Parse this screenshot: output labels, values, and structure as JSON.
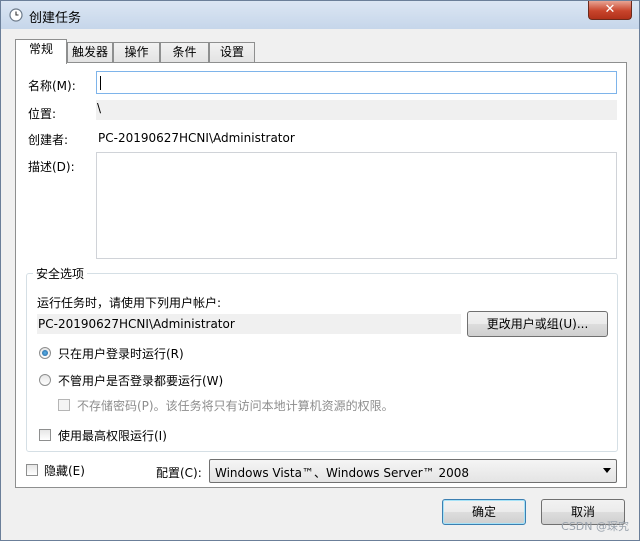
{
  "window": {
    "title": "创建任务",
    "close_glyph": "✕"
  },
  "tabs": [
    {
      "label": "常规"
    },
    {
      "label": "触发器"
    },
    {
      "label": "操作"
    },
    {
      "label": "条件"
    },
    {
      "label": "设置"
    }
  ],
  "general": {
    "name_label": "名称(M):",
    "name_value": "",
    "location_label": "位置:",
    "location_value": "\\",
    "author_label": "创建者:",
    "author_value": "PC-20190627HCNI\\Administrator",
    "description_label": "描述(D):",
    "description_value": ""
  },
  "security": {
    "group_title": "安全选项",
    "run_as_label": "运行任务时，请使用下列用户帐户:",
    "user_account": "PC-20190627HCNI\\Administrator",
    "change_user_button": "更改用户或组(U)...",
    "radio_logged_on": "只在用户登录时运行(R)",
    "radio_whether_logged": "不管用户是否登录都要运行(W)",
    "do_not_store_password": "不存储密码(P)。该任务将只有访问本地计算机资源的权限。",
    "highest_privileges": "使用最高权限运行(I)"
  },
  "bottom": {
    "hidden_label": "隐藏(E)",
    "configure_label": "配置(C):",
    "configure_value": "Windows Vista™、Windows Server™ 2008"
  },
  "buttons": {
    "ok": "确定",
    "cancel": "取消"
  },
  "watermark": "CSDN @琛究"
}
